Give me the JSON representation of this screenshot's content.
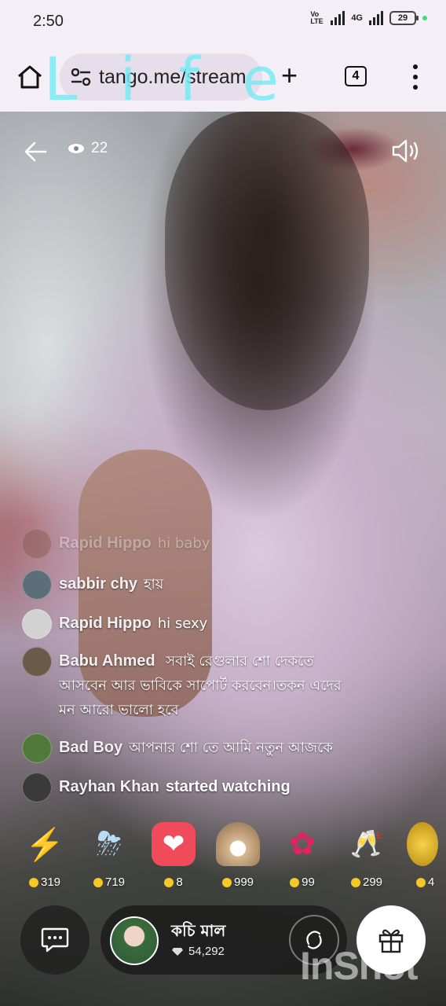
{
  "status_bar": {
    "time": "2:50",
    "network_label": "Vo LTE",
    "signal_label": "4G",
    "battery": "29"
  },
  "browser": {
    "url": "tango.me/stream",
    "tab_count": "4",
    "watermark": "Life"
  },
  "stream": {
    "viewer_count": "22",
    "chat": [
      {
        "user": "Rapid Hippo",
        "text": "hi baby",
        "avatar_color": "#7a4a3a"
      },
      {
        "user": "sabbir chy",
        "text": "হায়",
        "avatar_color": "#5c6e7a"
      },
      {
        "user": "Rapid Hippo",
        "text": "hi sexy",
        "avatar_color": "#c9c9c9"
      },
      {
        "user": "Babu Ahmed",
        "text": "সবাই রেগুলার শো দেকতে আসবেন আর ভাবিকে সাপোর্ট করবেন।তকন এদের মন আরো ভালো হবে",
        "avatar_color": "#6b5a4a"
      },
      {
        "user": "Bad Boy",
        "text": "আপনার শো তে আমি নতুন আজকে",
        "avatar_color": "#4f7a3c"
      },
      {
        "user": "Rayhan Khan",
        "text": "started watching",
        "avatar_color": "#3a3a3a"
      }
    ],
    "gifts": [
      {
        "icon": "lightning-icon",
        "glyph": "⚡",
        "price": "319"
      },
      {
        "icon": "storm-cloud-icon",
        "glyph": "⛈",
        "price": "719"
      },
      {
        "icon": "heart-message-icon",
        "glyph": "❤",
        "price": "8"
      },
      {
        "icon": "pearl-shell-icon",
        "glyph": "🐚",
        "price": "999"
      },
      {
        "icon": "rose-icon",
        "glyph": "🌹",
        "price": "99"
      },
      {
        "icon": "champagne-icon",
        "glyph": "🍾",
        "price": "299"
      },
      {
        "icon": "gold-coin-icon",
        "glyph": "●",
        "price": "4"
      }
    ],
    "host": {
      "name": "কচি মাল",
      "diamonds": "54,292"
    }
  },
  "overlay_watermark": "InShot"
}
